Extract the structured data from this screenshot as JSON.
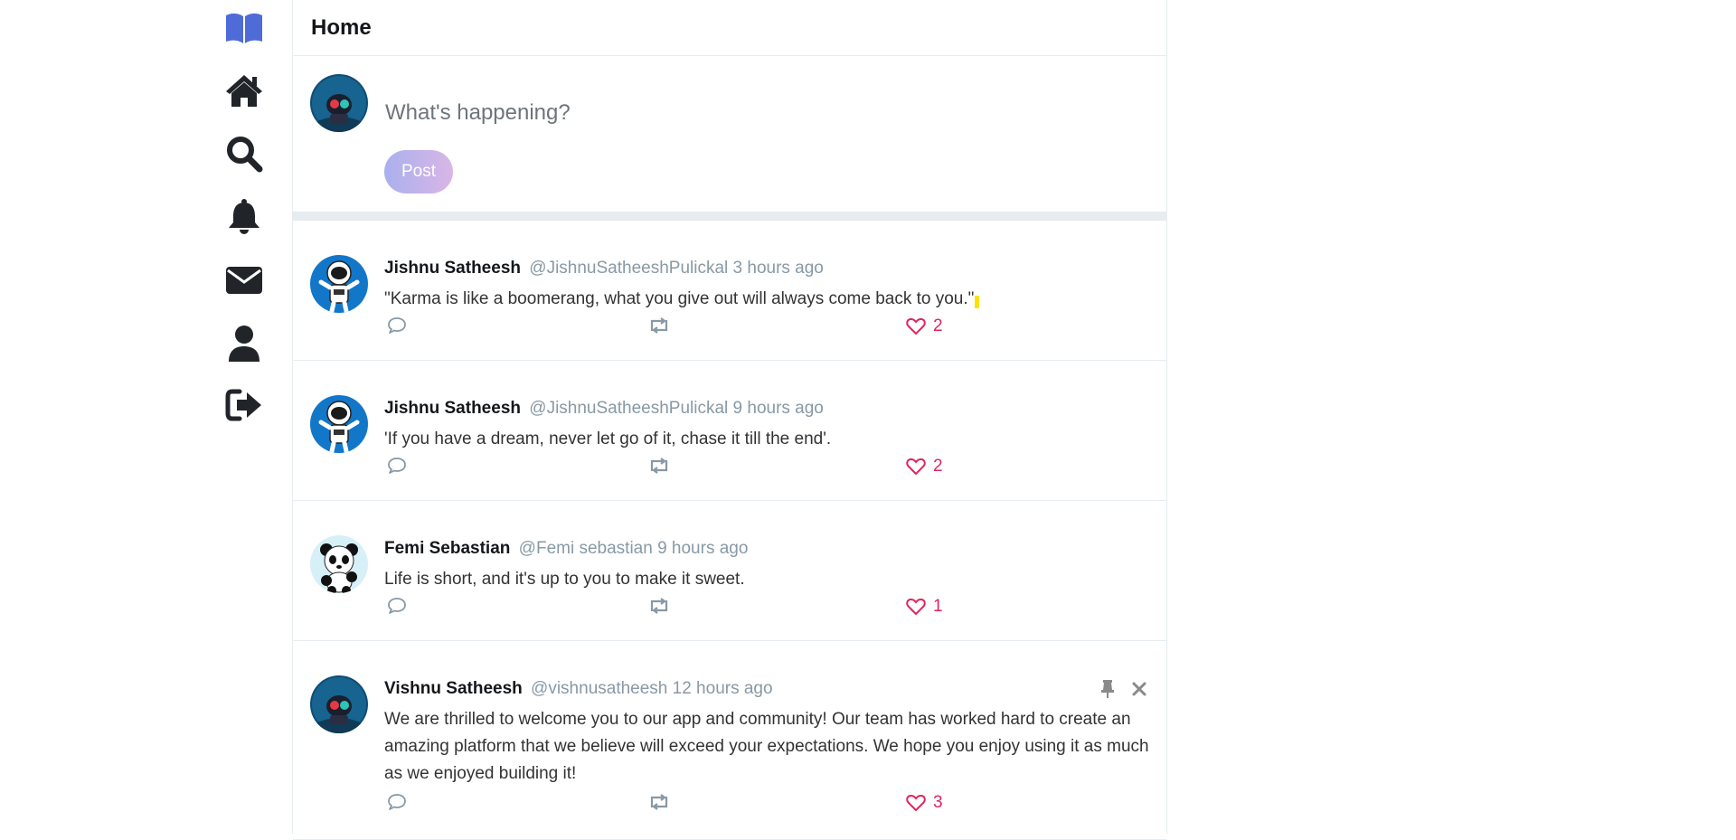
{
  "app": {
    "title": "Home"
  },
  "sidebar": {
    "items": [
      {
        "name": "logo",
        "icon": "book-open-icon"
      },
      {
        "name": "home",
        "icon": "home-icon"
      },
      {
        "name": "search",
        "icon": "search-icon"
      },
      {
        "name": "notifications",
        "icon": "bell-icon"
      },
      {
        "name": "messages",
        "icon": "envelope-icon"
      },
      {
        "name": "profile",
        "icon": "user-icon"
      },
      {
        "name": "logout",
        "icon": "sign-out-icon"
      }
    ]
  },
  "compose": {
    "placeholder": "What's happening?",
    "post_label": "Post"
  },
  "posts": [
    {
      "name": "Jishnu Satheesh",
      "meta": "@JishnuSatheeshPulickal 3 hours ago",
      "text": "\"Karma is like a boomerang, what you give out will always come back to you.\"",
      "likes": "2",
      "avatar": "astronaut-avatar"
    },
    {
      "name": "Jishnu Satheesh",
      "meta": "@JishnuSatheeshPulickal 9 hours ago",
      "text": "'If you have a dream, never let go of it, chase it till the end'.",
      "likes": "2",
      "avatar": "astronaut-avatar"
    },
    {
      "name": "Femi Sebastian",
      "meta": "@Femi sebastian 9 hours ago",
      "text": "Life is short, and it's up to you to make it sweet.",
      "likes": "1",
      "avatar": "panda-avatar"
    },
    {
      "name": "Vishnu Satheesh",
      "meta": "@vishnusatheesh 12 hours ago",
      "text": "We are thrilled to welcome you to our app and community! Our team has worked hard to create an amazing platform that we believe will exceed your expectations. We hope you enjoy using it as much as we enjoyed building it!",
      "likes": "3",
      "avatar": "diver-avatar"
    }
  ],
  "colors": {
    "accent": "#4f6bd8",
    "like": "#e0245e",
    "muted": "#8899a6",
    "divider": "#e6ecf0"
  }
}
